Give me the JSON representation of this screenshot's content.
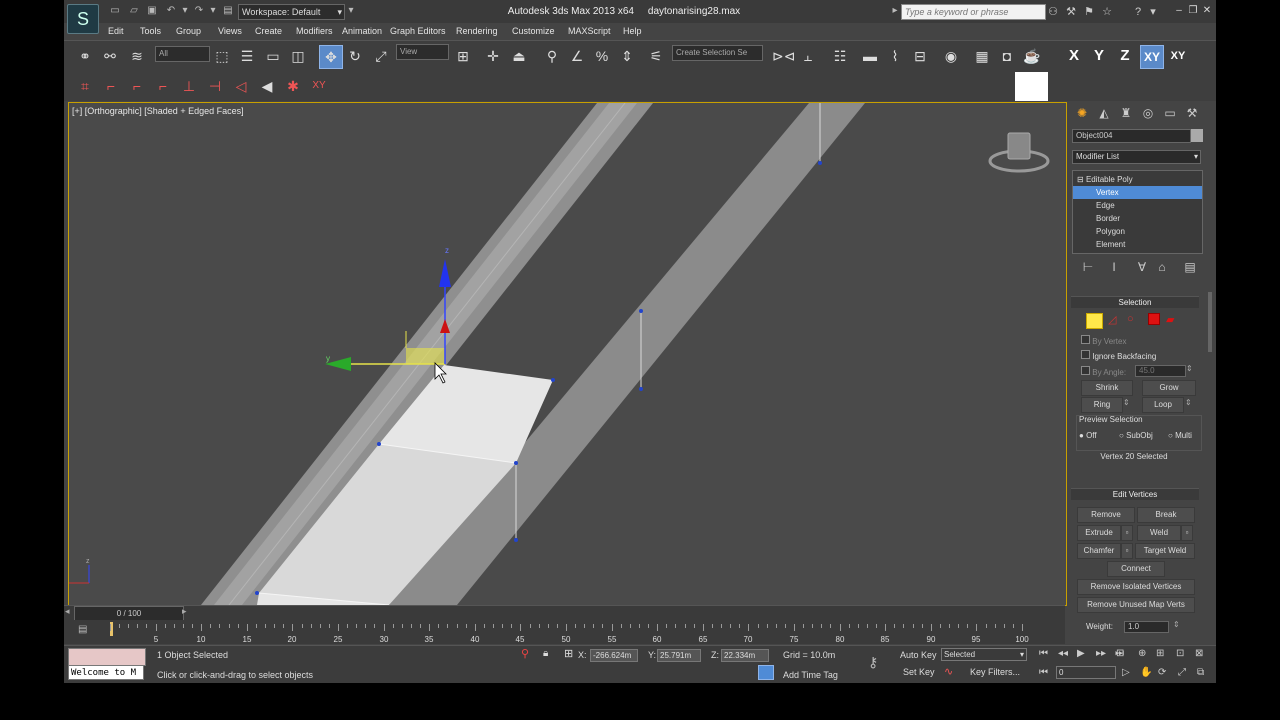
{
  "titlebar": {
    "app_title": "Autodesk 3ds Max  2013 x64",
    "file_name": "daytonarising28.max",
    "workspace_label": "Workspace: Default",
    "search_placeholder": "Type a keyword or phrase"
  },
  "menu": [
    "Edit",
    "Tools",
    "Group",
    "Views",
    "Create",
    "Modifiers",
    "Animation",
    "Graph Editors",
    "Rendering",
    "Customize",
    "MAXScript",
    "Help"
  ],
  "toolbar": {
    "selection_filter": "All",
    "reference_coord": "View",
    "named_selection": "Create Selection Se",
    "axis_buttons": [
      "X",
      "Y",
      "Z",
      "XY",
      "XY"
    ]
  },
  "toolbar2": {
    "xy_label": "XY"
  },
  "viewport": {
    "label": "[+] [Orthographic] [Shaded + Edged Faces]",
    "gizmo_axes": {
      "x": "x",
      "y": "y",
      "z": "z"
    }
  },
  "command_panel": {
    "object_name": "Object004",
    "modifier_list": "Modifier List",
    "stack": {
      "root": "Editable Poly",
      "subobjects": [
        "Vertex",
        "Edge",
        "Border",
        "Polygon",
        "Element"
      ],
      "selected": "Vertex"
    },
    "selection": {
      "title": "Selection",
      "by_vertex": "By Vertex",
      "ignore_backfacing": "Ignore Backfacing",
      "by_angle": "By Angle:",
      "angle_value": "45.0",
      "shrink": "Shrink",
      "grow": "Grow",
      "ring": "Ring",
      "loop": "Loop",
      "preview_title": "Preview Selection",
      "preview_off": "Off",
      "preview_subobj": "SubObj",
      "preview_multi": "Multi",
      "status": "Vertex 20 Selected"
    },
    "edit_vertices": {
      "title": "Edit Vertices",
      "remove": "Remove",
      "break": "Break",
      "extrude": "Extrude",
      "weld": "Weld",
      "chamfer": "Chamfer",
      "target_weld": "Target Weld",
      "connect": "Connect",
      "remove_isolated": "Remove Isolated Vertices",
      "remove_unused_map": "Remove Unused Map Verts",
      "weight_label": "Weight:",
      "weight_value": "1.0"
    }
  },
  "timeline": {
    "frame_label": "0 / 100",
    "ticks": [
      "5",
      "10",
      "15",
      "20",
      "25",
      "30",
      "35",
      "40",
      "45",
      "50",
      "55",
      "60",
      "65",
      "70",
      "75",
      "80",
      "85",
      "90",
      "95",
      "100"
    ]
  },
  "status": {
    "welcome": "Welcome to M",
    "selection_info": "1 Object Selected",
    "prompt": "Click or click-and-drag to select objects",
    "x_label": "X:",
    "x_value": "-266.624m",
    "y_label": "Y:",
    "y_value": "25.791m",
    "z_label": "Z:",
    "z_value": "22.334m",
    "grid": "Grid = 10.0m",
    "add_time_tag": "Add Time Tag",
    "auto_key": "Auto Key",
    "set_key": "Set Key",
    "key_mode": "Selected",
    "key_filters": "Key Filters...",
    "frame": "0"
  },
  "colors": {
    "accent_blue": "#4f8bd6",
    "viewport_bg": "#4a4a4a",
    "viewport_border": "#c8a000",
    "ui_bg": "#444444"
  }
}
